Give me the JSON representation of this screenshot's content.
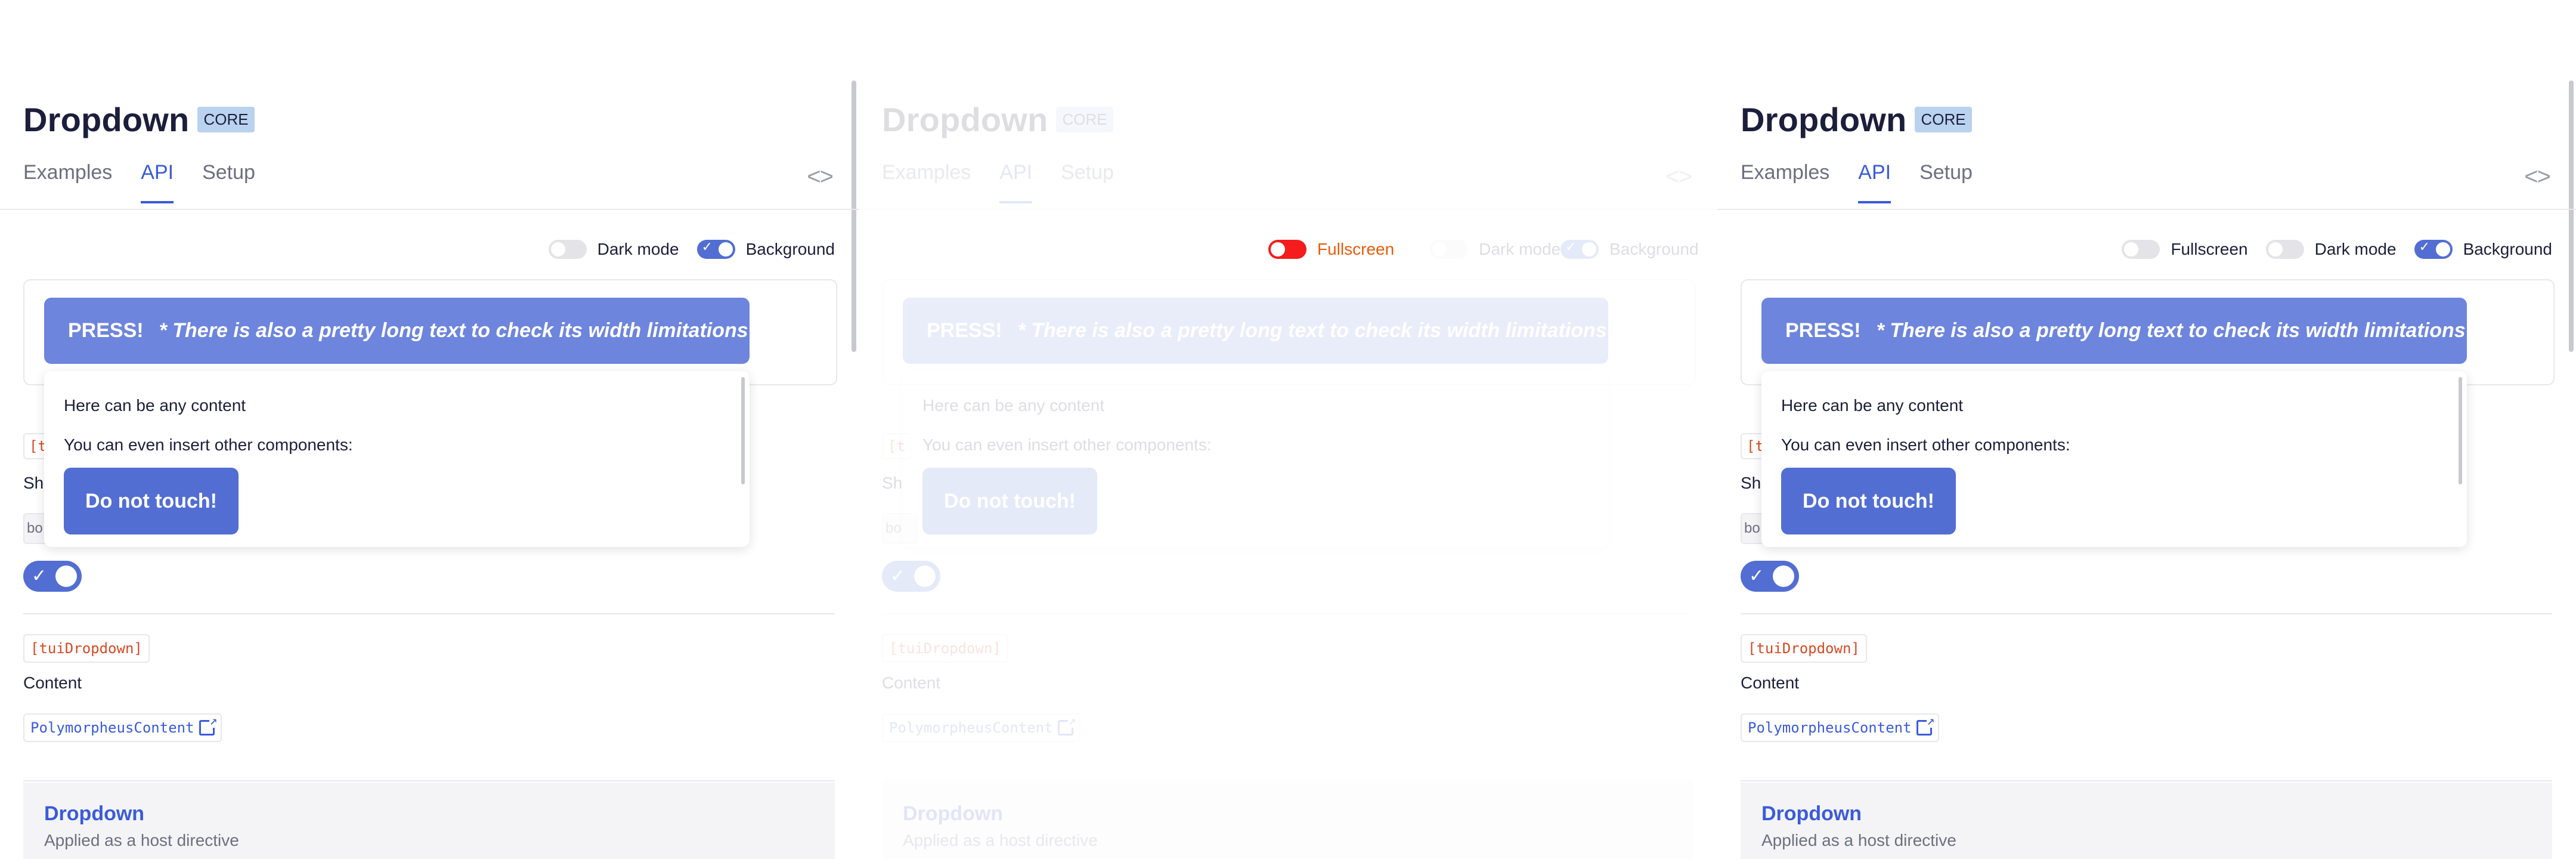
{
  "page": {
    "title": "Dropdown",
    "badge": "CORE",
    "tabs": [
      "Examples",
      "API",
      "Setup"
    ],
    "active_tab": "API",
    "code_icon": "<>"
  },
  "toggles": {
    "fullscreen": "Fullscreen",
    "dark_mode": "Dark mode",
    "background": "Background"
  },
  "demo": {
    "press_label": "PRESS!",
    "press_long_text": "* There is also a pretty long text to check its width limitations",
    "dropdown_line1": "Here can be any content",
    "dropdown_line2": "You can even insert other components:",
    "dropdown_button": "Do not touch!"
  },
  "partial": {
    "tag": "[t",
    "text": "Sh",
    "box": "bo"
  },
  "api": {
    "directive": "[tuiDropdown]",
    "content_label": "Content",
    "content_type": "PolymorpheusContent"
  },
  "card": {
    "title": "Dropdown",
    "subtitle": "Applied as a host directive"
  },
  "colors": {
    "accent": "#526ed3",
    "button_light": "#6d85dd",
    "code_red": "#d54a23",
    "fullscreen_on": "#f41c1c",
    "badge_bg": "#b9d2ef"
  }
}
